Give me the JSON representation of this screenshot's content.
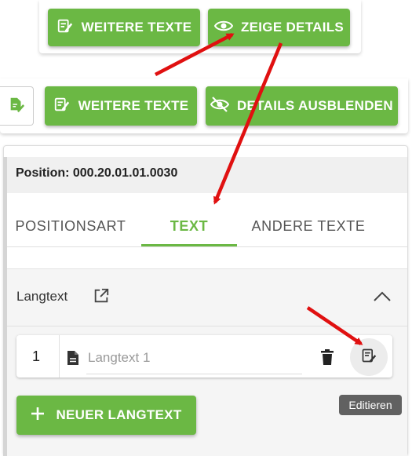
{
  "top_toolbar": {
    "more_texts_label": "WEITERE TEXTE",
    "show_details_label": "ZEIGE DETAILS"
  },
  "second_toolbar": {
    "more_texts_label": "WEITERE TEXTE",
    "hide_details_label": "DETAILS AUSBLENDEN"
  },
  "position": {
    "label": "Position: 000.20.01.01.0030"
  },
  "tabs": [
    {
      "label": "POSITIONSART",
      "active": false
    },
    {
      "label": "TEXT",
      "active": true
    },
    {
      "label": "ANDERE TEXTE",
      "active": false
    }
  ],
  "langtext_section": {
    "title": "Langtext",
    "row": {
      "number": "1",
      "name": "Langtext 1"
    },
    "new_button_label": "NEUER LANGTEXT",
    "tooltip": "Editieren"
  },
  "colors": {
    "accent": "#6bb844",
    "arrow": "#e01010",
    "tooltip_bg": "#616161"
  },
  "icons": [
    "edit-note-icon",
    "eye-icon",
    "eye-off-icon",
    "open-in-new-icon",
    "chevron-up-icon",
    "document-icon",
    "trash-icon",
    "plus-icon"
  ]
}
